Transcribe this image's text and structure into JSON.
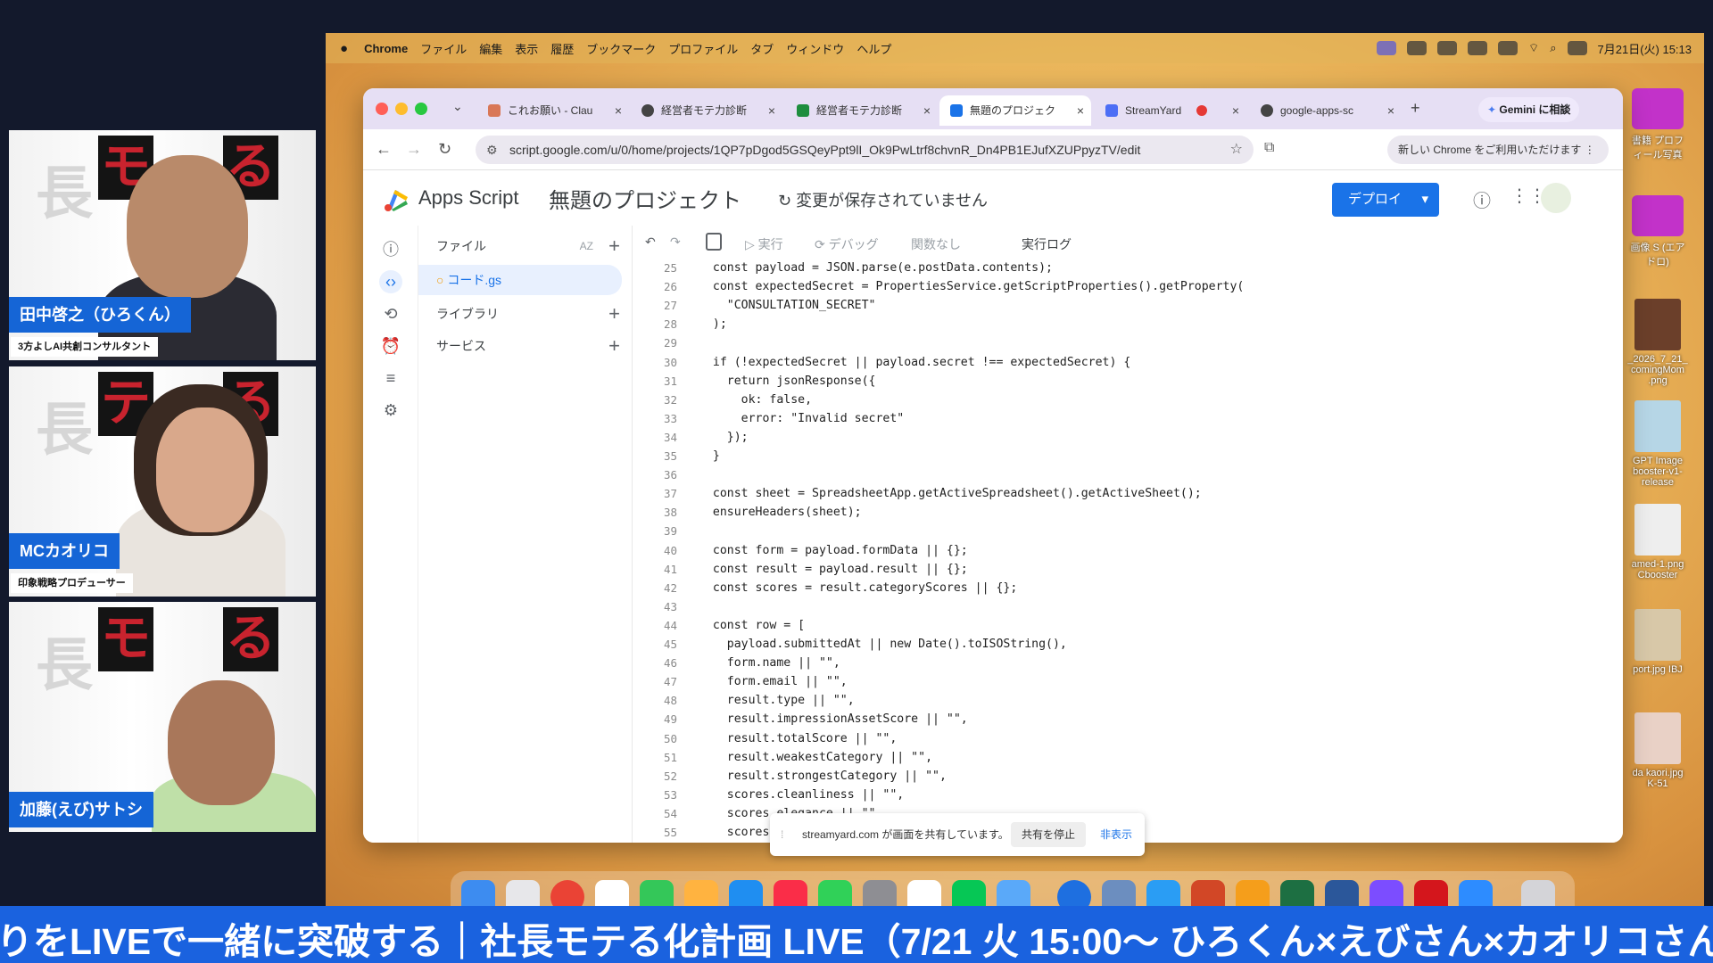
{
  "participants": [
    {
      "name": "田中啓之（ひろくん）",
      "role": "3方よしAI共創コンサルタント"
    },
    {
      "name": "MCカオリコ",
      "role": "印象戦略プロデューサー"
    },
    {
      "name": "加藤(えび)サトシ",
      "role": ""
    }
  ],
  "backdrop": {
    "chars": [
      "長",
      "モ",
      "る",
      "テ",
      "る"
    ]
  },
  "menubar": {
    "items": [
      "Chrome",
      "ファイル",
      "編集",
      "表示",
      "履歴",
      "ブックマーク",
      "プロファイル",
      "タブ",
      "ウィンドウ",
      "ヘルプ"
    ],
    "datetime": "7月21日(火) 15:13"
  },
  "tabs": [
    {
      "label": "これお願い - Clau",
      "color": "#d97757"
    },
    {
      "label": "経営者モテ力診断",
      "color": "#444444"
    },
    {
      "label": "経営者モテ力診断",
      "color": "#1e8e3e"
    },
    {
      "label": "無題のプロジェク",
      "color": "#1a73e8"
    },
    {
      "label": "StreamYard",
      "color": "#4c6ef5"
    },
    {
      "label": "google-apps-sc",
      "color": "#444444"
    }
  ],
  "gemini": "Gemini に相談",
  "address": "script.google.com/u/0/home/projects/1QP7pDgod5GSQeyPpt9lI_Ok9PwLtrf8chvnR_Dn4PB1EJufXZUPpyzTV/edit",
  "chrome_notice": "新しい Chrome をご利用いただけます",
  "appsscript": {
    "product": "Apps Script",
    "project_title": "無題のプロジェクト",
    "save_status": "変更が保存されていません",
    "deploy": "デプロイ"
  },
  "files_panel": {
    "title": "ファイル",
    "sort": "AZ",
    "file": "コード.gs",
    "libraries": "ライブラリ",
    "services": "サービス"
  },
  "toolbar": {
    "run": "実行",
    "debug": "デバッグ",
    "fn": "関数なし",
    "log": "実行ログ"
  },
  "code_lines": [
    {
      "n": "25",
      "t": "  const payload = JSON.parse(e.postData.contents);"
    },
    {
      "n": "26",
      "t": "  const expectedSecret = PropertiesService.getScriptProperties().getProperty("
    },
    {
      "n": "27",
      "t": "    \"CONSULTATION_SECRET\""
    },
    {
      "n": "28",
      "t": "  );"
    },
    {
      "n": "29",
      "t": ""
    },
    {
      "n": "30",
      "t": "  if (!expectedSecret || payload.secret !== expectedSecret) {"
    },
    {
      "n": "31",
      "t": "    return jsonResponse({"
    },
    {
      "n": "32",
      "t": "      ok: false,"
    },
    {
      "n": "33",
      "t": "      error: \"Invalid secret\""
    },
    {
      "n": "34",
      "t": "    });"
    },
    {
      "n": "35",
      "t": "  }"
    },
    {
      "n": "36",
      "t": ""
    },
    {
      "n": "37",
      "t": "  const sheet = SpreadsheetApp.getActiveSpreadsheet().getActiveSheet();"
    },
    {
      "n": "38",
      "t": "  ensureHeaders(sheet);"
    },
    {
      "n": "39",
      "t": ""
    },
    {
      "n": "40",
      "t": "  const form = payload.formData || {};"
    },
    {
      "n": "41",
      "t": "  const result = payload.result || {};"
    },
    {
      "n": "42",
      "t": "  const scores = result.categoryScores || {};"
    },
    {
      "n": "43",
      "t": ""
    },
    {
      "n": "44",
      "t": "  const row = ["
    },
    {
      "n": "45",
      "t": "    payload.submittedAt || new Date().toISOString(),"
    },
    {
      "n": "46",
      "t": "    form.name || \"\","
    },
    {
      "n": "47",
      "t": "    form.email || \"\","
    },
    {
      "n": "48",
      "t": "    result.type || \"\","
    },
    {
      "n": "49",
      "t": "    result.impressionAssetScore || \"\","
    },
    {
      "n": "50",
      "t": "    result.totalScore || \"\","
    },
    {
      "n": "51",
      "t": "    result.weakestCategory || \"\","
    },
    {
      "n": "52",
      "t": "    result.strongestCategory || \"\","
    },
    {
      "n": "53",
      "t": "    scores.cleanliness || \"\","
    },
    {
      "n": "54",
      "t": "    scores.elegance || \"\""
    },
    {
      "n": "55",
      "t": "    scores.prese"
    }
  ],
  "sharebar": {
    "message": "streamyard.com が画面を共有しています。",
    "stop": "共有を停止",
    "hide": "非表示"
  },
  "desktop": [
    {
      "label": "書籍 プロフィール写真"
    },
    {
      "label": "画像 S (エアドロ)"
    },
    {
      "label": "_2026_7_21_ comingMom .png"
    },
    {
      "label": "GPT Image booster-v1- release"
    },
    {
      "label": "amed-1.png Cbooster"
    },
    {
      "label": "port.jpg IBJ"
    },
    {
      "label": "da kaori.jpg K-51"
    }
  ],
  "ticker": "りをLIVEで一緒に突破する｜社長モテる化計画 LIVE（7/21 火 15:00〜 ひろくん×えびさん×カオリコさん"
}
